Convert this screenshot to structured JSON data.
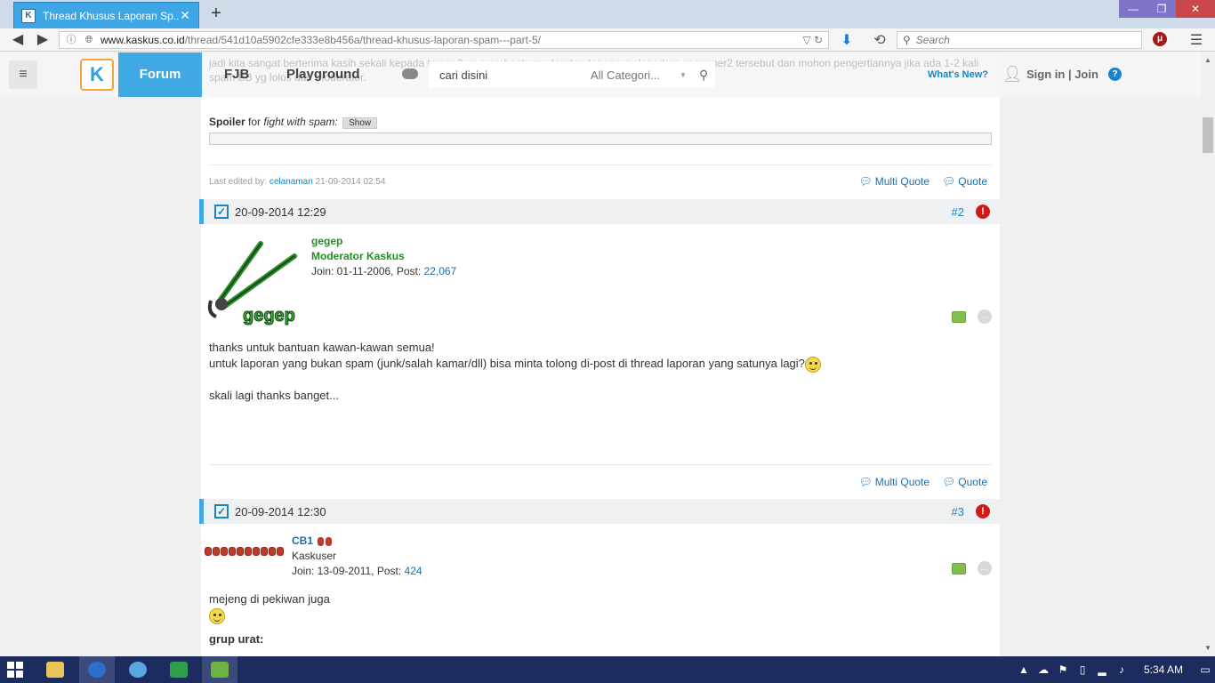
{
  "browser": {
    "tab_title": "Thread Khusus Laporan Sp...",
    "tab_favicon": "kaskus-favicon",
    "url_domain": "www.kaskus.co.id",
    "url_path": "/thread/541d10a5902cfe333e8b456a/thread-khusus-laporan-spam---part-5/",
    "search_placeholder": "Search",
    "ublock_label": "μ"
  },
  "site": {
    "forum_label": "Forum",
    "fjb_label": "FJB",
    "playground_label": "Playground",
    "search_value": "cari disini",
    "category_value": "All Categori...",
    "whats_new": "What's New?",
    "signin": "Sign in | Join",
    "help": "?",
    "bg_text": "jadi kita sangat berterima kasih sekali kepada teman2 yg membantu moderator dengan melaporkan spammer2 tersebut dan mohon pengertiannya jika ada 1-2 kali spam BB yg lolos dari moderator."
  },
  "post1": {
    "spoiler_label": "Spoiler",
    "spoiler_for": "for",
    "spoiler_title": "fight with spam:",
    "show_label": "Show",
    "last_edited_label": "Last edited by:",
    "last_edited_user": "celanaman",
    "last_edited_time": "21-09-2014 02:54",
    "multi_quote": "Multi Quote",
    "quote": "Quote"
  },
  "post2": {
    "date": "20-09-2014 12:29",
    "number": "#2",
    "username": "gegep",
    "role": "Moderator Kaskus",
    "join_label": "Join: 01-11-2006, Post:",
    "post_count": "22,067",
    "line1": "thanks untuk bantuan kawan-kawan semua!",
    "line2": "untuk laporan yang bukan spam (junk/salah kamar/dll) bisa minta tolong di-post di thread laporan yang satunya lagi?",
    "line3": "skali lagi thanks banget...",
    "multi_quote": "Multi Quote",
    "quote": "Quote",
    "avatar_label": "gegep"
  },
  "post3": {
    "date": "20-09-2014 12:30",
    "number": "#3",
    "username": "CB1",
    "role": "Kaskuser",
    "join_label": "Join: 13-09-2011, Post:",
    "post_count": "424",
    "line1": "mejeng di pekiwan juga",
    "line2": "grup urat:"
  },
  "taskbar": {
    "clock": "5:34 AM"
  },
  "colors": {
    "accent": "#3fa9e3",
    "link": "#1a6fb0",
    "moderator_green": "#1f8f1f",
    "taskbar": "#1c2c5e"
  }
}
